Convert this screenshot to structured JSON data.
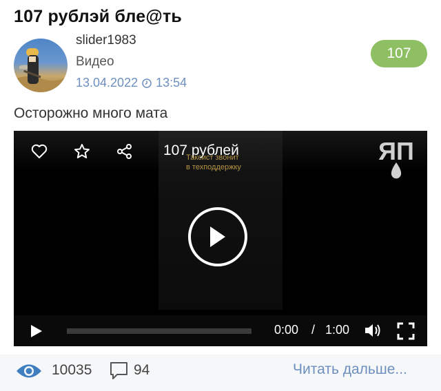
{
  "post": {
    "title": "107 рублэй бле@ть",
    "author": "slider1983",
    "category": "Видео",
    "date": "13.04.2022",
    "time": "13:54",
    "rating": "107",
    "description": "Осторожно много мата"
  },
  "player": {
    "title": "107 рублей",
    "overlay_line1": "Таксист звонит",
    "overlay_line2": "в техподдержку",
    "logo_text": "ЯП",
    "current_time": "0:00",
    "separator": "/",
    "duration": "1:00",
    "progress": 0,
    "icons": [
      "heart-icon",
      "star-icon",
      "share-icon",
      "play-icon",
      "volume-icon",
      "fullscreen-icon"
    ]
  },
  "footer": {
    "views": "10035",
    "comments": "94",
    "read_more": "Читать дальше..."
  },
  "colors": {
    "rating_bg": "#8fbf63",
    "link": "#6d8fbf",
    "eye": "#3f7fc0"
  }
}
